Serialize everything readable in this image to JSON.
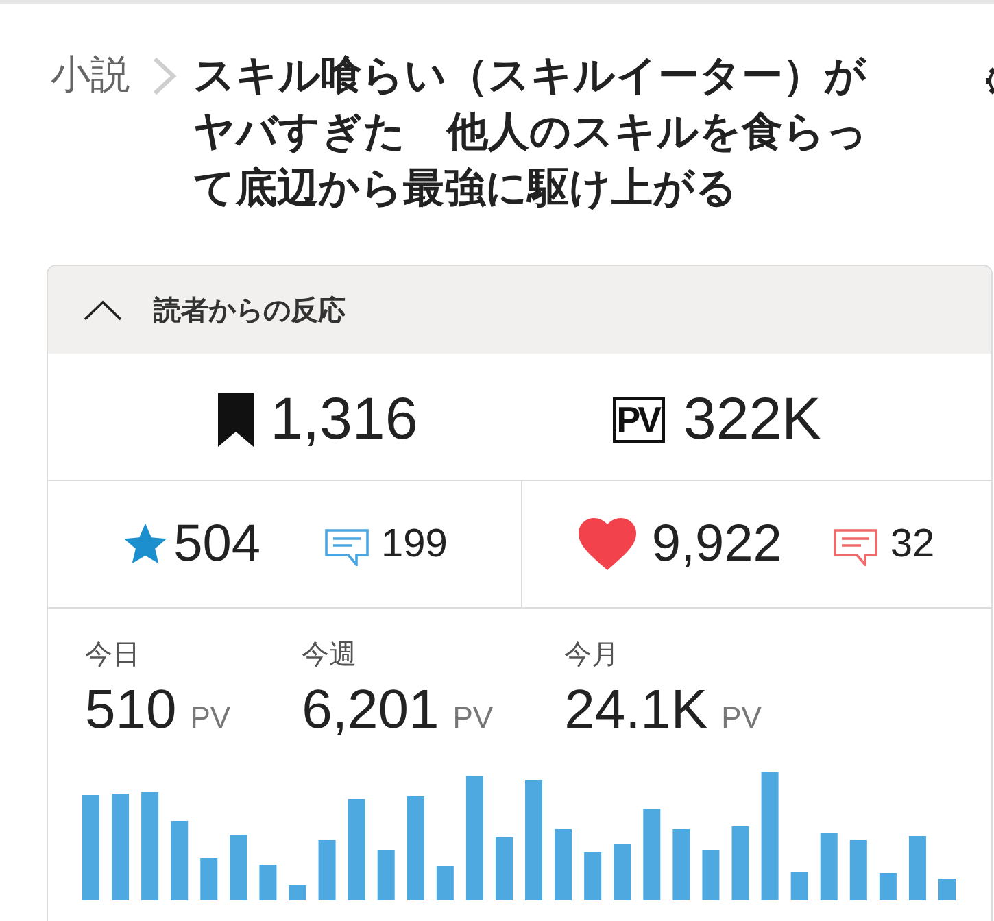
{
  "header": {
    "category": "小説",
    "title": "スキル喰らい（スキルイーター）がヤバすぎた　他人のスキルを食らって底辺から最強に駆け上がる"
  },
  "reactions": {
    "title": "読者からの反応",
    "expanded": true,
    "totals": [
      {
        "kind": "bookmark",
        "value": "1,316"
      },
      {
        "kind": "pv",
        "badge": "PV",
        "value": "322K"
      }
    ],
    "scores": [
      {
        "kind": "points",
        "value": "504",
        "comments": "199"
      },
      {
        "kind": "likes",
        "value": "9,922",
        "comments": "32"
      }
    ],
    "periods": [
      {
        "label": "今日",
        "value": "510",
        "unit": "PV"
      },
      {
        "label": "今週",
        "value": "6,201",
        "unit": "PV"
      },
      {
        "label": "今月",
        "value": "24.1K",
        "unit": "PV"
      }
    ]
  }
}
